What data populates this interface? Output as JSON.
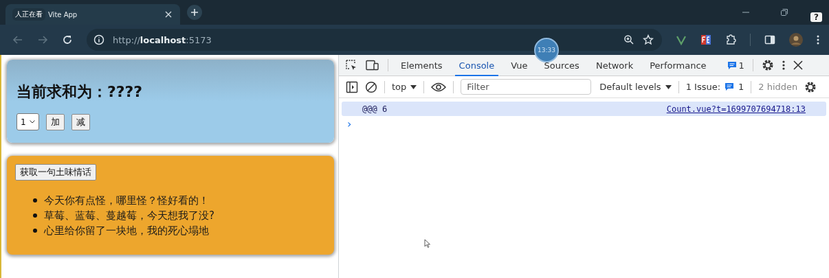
{
  "window": {
    "tab_title": "Vite App",
    "overlay_label": "人正在看",
    "timer": "13:33",
    "help_badge": "?"
  },
  "browser": {
    "url": "http://**localhost**:5173"
  },
  "page": {
    "sum_heading": "当前求和为：????",
    "step_select": "1",
    "buttons": [
      "加",
      "减"
    ],
    "fetch_button": "获取一句土味情话",
    "sayings": [
      "今天你有点怪，哪里怪？怪好看的！",
      "草莓、蓝莓、蔓越莓，今天想我了没?",
      "心里给你留了一块地，我的死心塌地"
    ]
  },
  "devtools": {
    "tabs": [
      {
        "label": "Elements",
        "selected": false
      },
      {
        "label": "Console",
        "selected": true
      },
      {
        "label": "Vue",
        "selected": false
      },
      {
        "label": "Sources",
        "selected": false
      },
      {
        "label": "Network",
        "selected": false
      },
      {
        "label": "Performance",
        "selected": false
      }
    ],
    "message_count": "1",
    "context": "top",
    "filter_placeholder": "Filter",
    "levels": "Default levels",
    "issues_label": "1 Issue:",
    "issues_count": "1",
    "hidden": "2 hidden",
    "messages": [
      {
        "text": "@@@ 6",
        "source": "Count.vue?t=1699707694718:13"
      }
    ],
    "prompt": "›"
  }
}
